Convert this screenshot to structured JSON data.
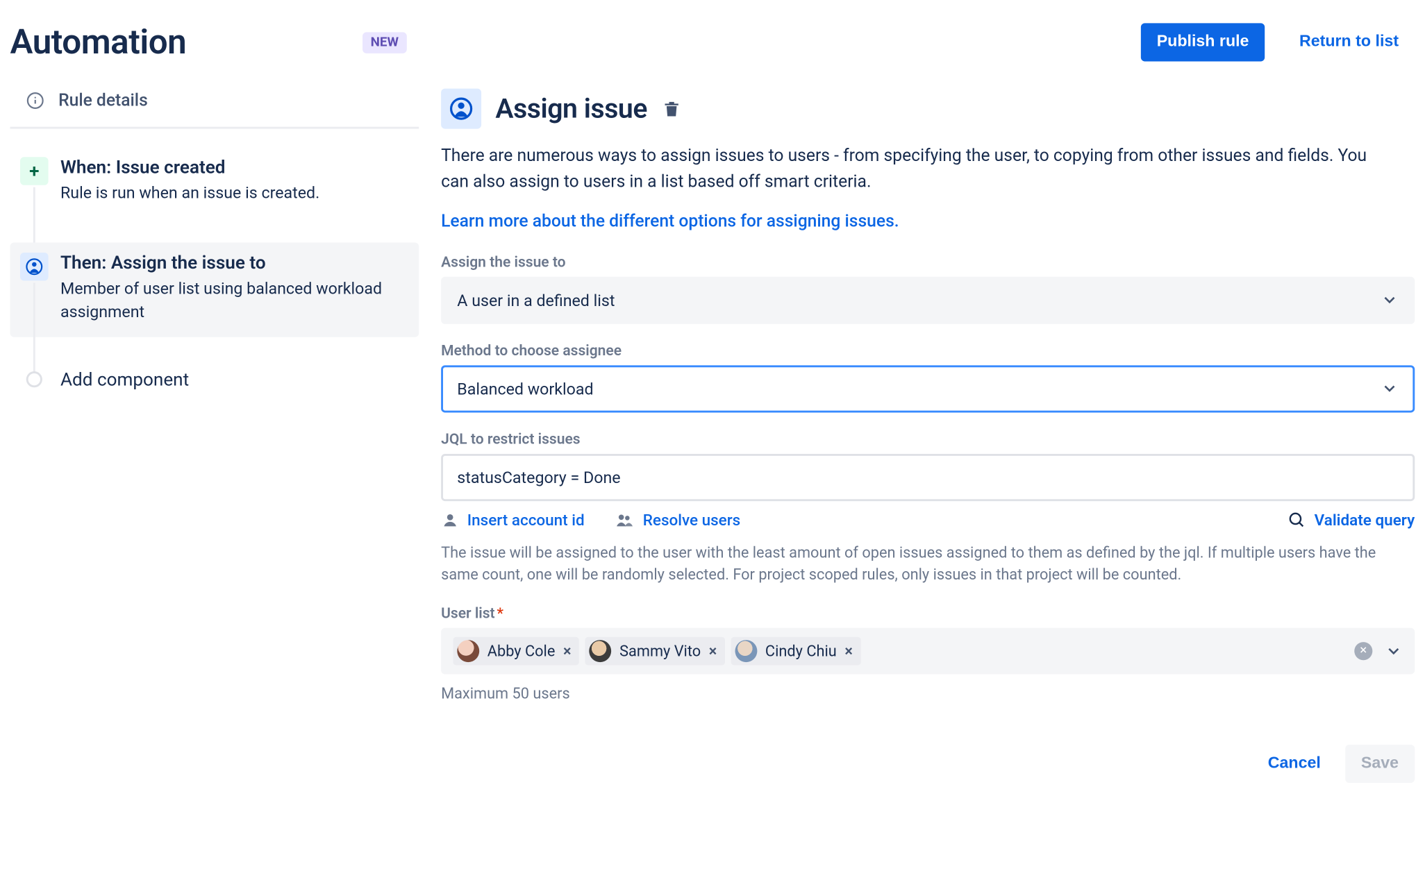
{
  "header": {
    "title": "Automation",
    "new_badge": "NEW",
    "publish_label": "Publish rule",
    "return_label": "Return to list"
  },
  "sidebar": {
    "rule_details_label": "Rule details",
    "steps": [
      {
        "title": "When: Issue created",
        "desc": "Rule is run when an issue is created."
      },
      {
        "title": "Then: Assign the issue to",
        "desc": "Member of user list using balanced workload assignment"
      }
    ],
    "add_component_label": "Add component"
  },
  "main": {
    "title": "Assign issue",
    "intro": "There are numerous ways to assign issues to users - from specifying the user, to copying from other issues and fields. You can also assign to users in a list based off smart criteria.",
    "learn_link": "Learn more about the different options for assigning issues.",
    "fields": {
      "assign_to_label": "Assign the issue to",
      "assign_to_value": "A user in a defined list",
      "method_label": "Method to choose assignee",
      "method_value": "Balanced workload",
      "jql_label": "JQL to restrict issues",
      "jql_value": "statusCategory = Done",
      "jql_actions": {
        "insert": "Insert account id",
        "resolve": "Resolve users",
        "validate": "Validate query"
      },
      "jql_helper": "The issue will be assigned to the user with the least amount of open issues assigned to them as defined by the jql. If multiple users have the same count, one will be randomly selected. For project scoped rules, only issues in that project will be counted.",
      "userlist_label": "User list",
      "users": [
        {
          "name": "Abby Cole"
        },
        {
          "name": "Sammy Vito"
        },
        {
          "name": "Cindy Chiu"
        }
      ],
      "userlist_helper": "Maximum 50 users"
    },
    "footer": {
      "cancel": "Cancel",
      "save": "Save"
    }
  }
}
